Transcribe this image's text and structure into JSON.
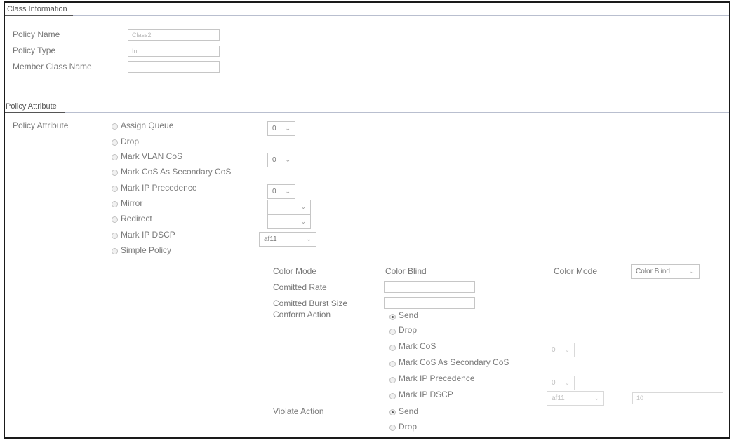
{
  "class_info": {
    "title": "Class Information",
    "policy_name_label": "Policy Name",
    "policy_name_value": "Class2",
    "policy_type_label": "Policy Type",
    "policy_type_value": "In",
    "member_class_label": "Member Class Name",
    "member_class_value": ""
  },
  "policy_attr": {
    "title": "Policy Attribute",
    "label": "Policy Attribute",
    "options": {
      "assign_queue": "Assign Queue",
      "drop": "Drop",
      "mark_vlan_cos": "Mark VLAN CoS",
      "mark_cos_secondary": "Mark CoS As Secondary CoS",
      "mark_ip_precedence": "Mark IP Precedence",
      "mirror": "Mirror",
      "redirect": "Redirect",
      "mark_ip_dscp": "Mark IP DSCP",
      "simple_policy": "Simple Policy"
    },
    "selects": {
      "assign_queue": "0",
      "mark_vlan_cos": "0",
      "mark_ip_precedence": "0",
      "mirror": "",
      "redirect": "",
      "mark_ip_dscp": "af11"
    }
  },
  "simple_policy": {
    "color_mode_label": "Color Mode",
    "color_mode_value": "Color Blind",
    "color_mode_label2": "Color Mode",
    "color_mode_select": "Color Blind",
    "committed_rate_label": "Comitted Rate",
    "committed_burst_label": "Comitted Burst Size",
    "conform_action_label": "Conform Action",
    "conform_options": {
      "send": "Send",
      "drop": "Drop",
      "mark_cos": "Mark CoS",
      "mark_cos_secondary": "Mark CoS As Secondary CoS",
      "mark_ip_precedence": "Mark IP Precedence",
      "mark_ip_dscp": "Mark IP DSCP"
    },
    "conform_selects": {
      "mark_cos": "0",
      "mark_ip_precedence": "0",
      "mark_ip_dscp": "af11"
    },
    "dscp_value": "10",
    "violate_action_label": "Violate Action",
    "violate_options": {
      "send": "Send",
      "drop": "Drop"
    }
  },
  "icons": {
    "chevron": "⌄"
  }
}
